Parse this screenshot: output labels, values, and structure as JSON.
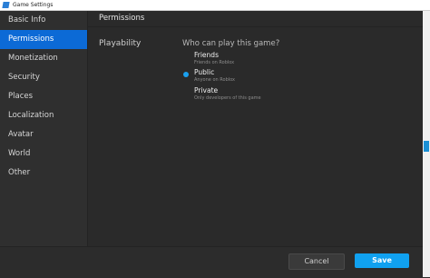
{
  "window": {
    "title": "Game Settings"
  },
  "sidebar": {
    "items": [
      {
        "label": "Basic Info",
        "active": false
      },
      {
        "label": "Permissions",
        "active": true
      },
      {
        "label": "Monetization",
        "active": false
      },
      {
        "label": "Security",
        "active": false
      },
      {
        "label": "Places",
        "active": false
      },
      {
        "label": "Localization",
        "active": false
      },
      {
        "label": "Avatar",
        "active": false
      },
      {
        "label": "World",
        "active": false
      },
      {
        "label": "Other",
        "active": false
      }
    ]
  },
  "main": {
    "header": "Permissions",
    "section_label": "Playability",
    "question": "Who can play this game?",
    "options": [
      {
        "label": "Friends",
        "desc": "Friends on Roblox",
        "selected": false
      },
      {
        "label": "Public",
        "desc": "Anyone on Roblox",
        "selected": true
      },
      {
        "label": "Private",
        "desc": "Only developers of this game",
        "selected": false
      }
    ]
  },
  "footer": {
    "cancel_label": "Cancel",
    "save_label": "Save"
  },
  "colors": {
    "accent": "#10a1f0",
    "selected_nav": "#0c6ad6",
    "background": "#2e2e2e"
  }
}
